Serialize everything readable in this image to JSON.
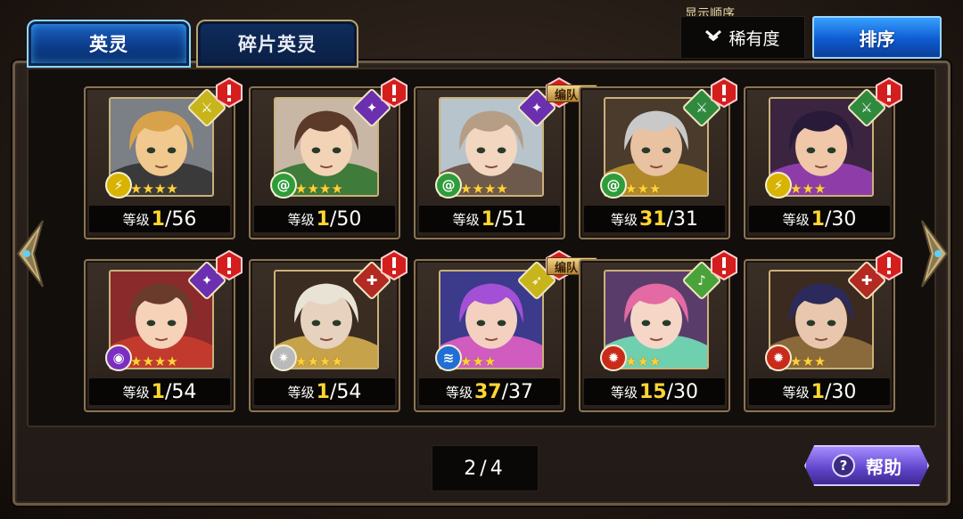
{
  "tabs": [
    {
      "label": "英灵",
      "active": true
    },
    {
      "label": "碎片英灵",
      "active": false
    }
  ],
  "sort": {
    "caption": "显示顺序",
    "current": "稀有度",
    "button_label": "排序"
  },
  "level_label": "等级",
  "party_label": "编队中",
  "cards": [
    {
      "cur": "1",
      "max": "56",
      "class_color": "#c7b51b",
      "class_glyph": "⚔",
      "element": "bolt",
      "element_color": "#d8b400",
      "element_glyph": "⚡",
      "stars": 4,
      "in_party": false,
      "portrait": {
        "hair": "#d8a24a",
        "skin": "#f1c88d",
        "bg": "#7b7f86",
        "acc": "#3a3a3a"
      }
    },
    {
      "cur": "1",
      "max": "50",
      "class_color": "#6b2fb0",
      "class_glyph": "✦",
      "element": "wind",
      "element_color": "#2f9c3a",
      "element_glyph": "@",
      "stars": 4,
      "in_party": false,
      "portrait": {
        "hair": "#5b3a2a",
        "skin": "#f3d3b6",
        "bg": "#c9b7a6",
        "acc": "#3f7b3a"
      }
    },
    {
      "cur": "1",
      "max": "51",
      "class_color": "#6b2fb0",
      "class_glyph": "✦",
      "element": "wind",
      "element_color": "#2f9c3a",
      "element_glyph": "@",
      "stars": 4,
      "in_party": true,
      "portrait": {
        "hair": "#b59d86",
        "skin": "#f2d6bf",
        "bg": "#b8c4cb",
        "acc": "#6e5a4c"
      }
    },
    {
      "cur": "31",
      "max": "31",
      "class_color": "#2f8a3e",
      "class_glyph": "⚔",
      "element": "wind",
      "element_color": "#2f9c3a",
      "element_glyph": "@",
      "stars": 3,
      "in_party": false,
      "portrait": {
        "hair": "#c9c9c9",
        "skin": "#e8c2a1",
        "bg": "#4a3b2c",
        "acc": "#b0892a"
      }
    },
    {
      "cur": "1",
      "max": "30",
      "class_color": "#2f8a3e",
      "class_glyph": "⚔",
      "element": "bolt",
      "element_color": "#d8b400",
      "element_glyph": "⚡",
      "stars": 3,
      "in_party": false,
      "portrait": {
        "hair": "#2a1a3a",
        "skin": "#f0c7a8",
        "bg": "#3a2440",
        "acc": "#8e3da8"
      }
    },
    {
      "cur": "1",
      "max": "54",
      "class_color": "#6b2fb0",
      "class_glyph": "✦",
      "element": "eye",
      "element_color": "#7a2fc0",
      "element_glyph": "◉",
      "stars": 4,
      "in_party": false,
      "portrait": {
        "hair": "#6a3a2a",
        "skin": "#f5d2b8",
        "bg": "#8a2a2a",
        "acc": "#c23a2e"
      }
    },
    {
      "cur": "1",
      "max": "54",
      "class_color": "#b22a22",
      "class_glyph": "✚",
      "element": "star",
      "element_color": "#b9b9b9",
      "element_glyph": "✷",
      "stars": 4,
      "in_party": false,
      "portrait": {
        "hair": "#e9e3d6",
        "skin": "#e7d2bf",
        "bg": "#3a2c20",
        "acc": "#c6a24a"
      }
    },
    {
      "cur": "37",
      "max": "37",
      "class_color": "#c7b51b",
      "class_glyph": "➶",
      "element": "water",
      "element_color": "#1f6fd4",
      "element_glyph": "≋",
      "stars": 3,
      "in_party": true,
      "portrait": {
        "hair": "#a34fd6",
        "skin": "#f3d0c0",
        "bg": "#3c3a8a",
        "acc": "#d05cc0"
      }
    },
    {
      "cur": "15",
      "max": "30",
      "class_color": "#4aa33a",
      "class_glyph": "♪",
      "element": "fire",
      "element_color": "#c92a1a",
      "element_glyph": "✹",
      "stars": 3,
      "in_party": false,
      "portrait": {
        "hair": "#e46aa3",
        "skin": "#f6d6c7",
        "bg": "#5a3c6a",
        "acc": "#6fd0b0"
      }
    },
    {
      "cur": "1",
      "max": "30",
      "class_color": "#b22a22",
      "class_glyph": "✚",
      "element": "fire",
      "element_color": "#c92a1a",
      "element_glyph": "✹",
      "stars": 3,
      "in_party": false,
      "portrait": {
        "hair": "#2b2a5a",
        "skin": "#e9c6ae",
        "bg": "#3a2a20",
        "acc": "#8a6a3a"
      }
    }
  ],
  "pager": {
    "current": "2",
    "separator": "/",
    "total": "4"
  },
  "help": {
    "label": "帮助",
    "icon": "?"
  }
}
